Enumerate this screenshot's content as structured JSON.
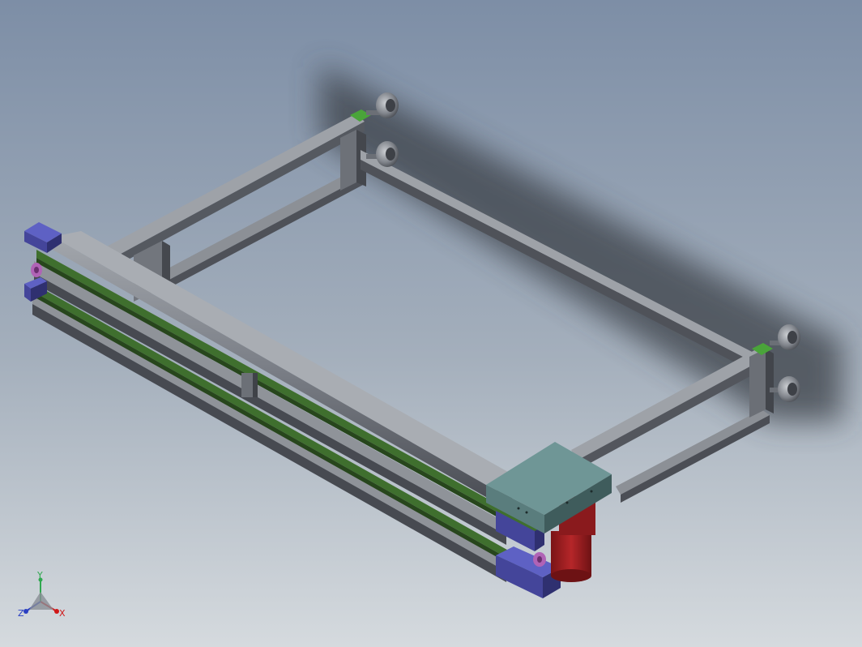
{
  "viewport": {
    "background_top": "#7d8ea6",
    "background_bottom": "#d5dade"
  },
  "model": {
    "profile_color": "#7a7e86",
    "profile_dark": "#4a4d54",
    "belt_color": "#3f6f2e",
    "end_cap_color": "#44459a",
    "motor_color": "#9c1f22",
    "gearbox_color": "#6f9696",
    "foot_color": "#7b7f86"
  },
  "triad": {
    "x_label": "X",
    "y_label": "Y",
    "z_label": "Z",
    "x_color": "#d01818",
    "y_color": "#2fa84f",
    "z_color": "#2a3fc2"
  }
}
